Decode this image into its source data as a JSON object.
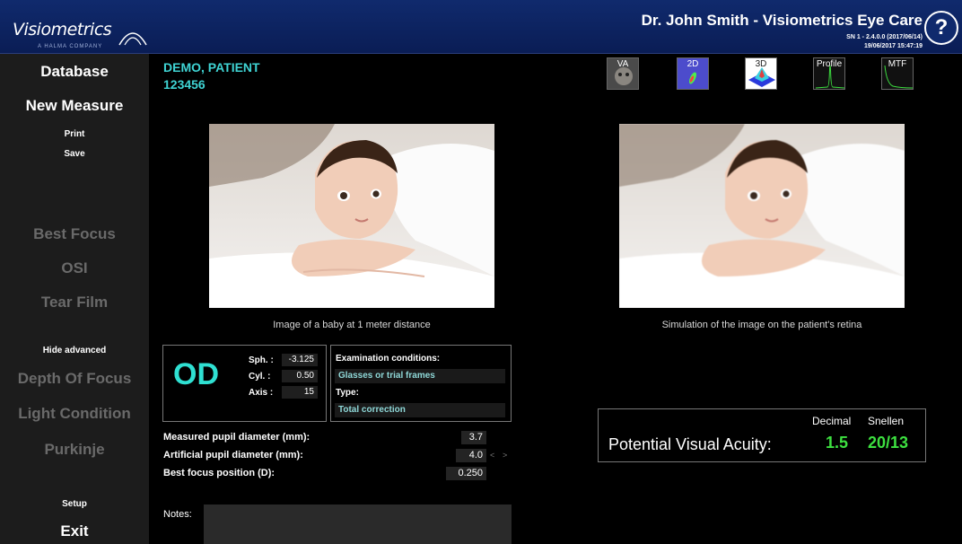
{
  "header": {
    "logo_text": "Visiometrics",
    "logo_sub": "A HALMA COMPANY",
    "title": "Dr. John Smith - Visiometrics Eye Care",
    "serial": "SN 1 - 2.4.0.0 (2017/06/14)",
    "datetime": "19/06/2017 15:47:19",
    "help_label": "?"
  },
  "sidebar": {
    "database": "Database",
    "new_measure": "New Measure",
    "print": "Print",
    "save": "Save",
    "best_focus": "Best Focus",
    "osi": "OSI",
    "tear_film": "Tear Film",
    "hide_advanced": "Hide advanced",
    "depth_of_focus": "Depth Of Focus",
    "light_condition": "Light Condition",
    "purkinje": "Purkinje",
    "setup": "Setup",
    "exit": "Exit"
  },
  "patient": {
    "name": "DEMO, PATIENT",
    "id": "123456"
  },
  "view_buttons": {
    "va": "VA",
    "two_d": "2D",
    "three_d": "3D",
    "profile": "Profile",
    "mtf": "MTF"
  },
  "images": {
    "left_caption": "Image of a baby at 1 meter distance",
    "right_caption": "Simulation of the image on the patient's retina"
  },
  "refraction": {
    "eye": "OD",
    "sph_label": "Sph. :",
    "sph_value": "-3.125",
    "cyl_label": "Cyl. :",
    "cyl_value": "0.50",
    "axis_label": "Axis :",
    "axis_value": "15"
  },
  "exam": {
    "conditions_label": "Examination conditions:",
    "conditions_value": "Glasses or trial frames",
    "type_label": "Type:",
    "type_value": "Total correction"
  },
  "measurements": {
    "measured_pupil_label": "Measured pupil diameter (mm):",
    "measured_pupil_value": "3.7",
    "artificial_pupil_label": "Artificial pupil diameter (mm):",
    "artificial_pupil_value": "4.0",
    "best_focus_label": "Best focus position (D):",
    "best_focus_value": "0.250"
  },
  "notes": {
    "label": "Notes:"
  },
  "pva": {
    "decimal_header": "Decimal",
    "snellen_header": "Snellen",
    "label": "Potential Visual Acuity:",
    "decimal_value": "1.5",
    "snellen_value": "20/13"
  }
}
